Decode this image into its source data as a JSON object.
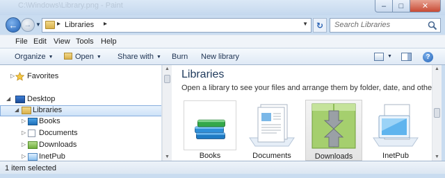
{
  "window": {
    "title": "C:\\Windows\\Library.png - Paint",
    "controls": {
      "minimize": "–",
      "maximize": "□",
      "close": "✕"
    }
  },
  "address": {
    "crumb": "Libraries",
    "search_placeholder": "Search Libraries"
  },
  "menu": [
    "File",
    "Edit",
    "View",
    "Tools",
    "Help"
  ],
  "commands": {
    "organize": "Organize",
    "open": "Open",
    "share_with": "Share with",
    "burn": "Burn",
    "new_library": "New library"
  },
  "nav": {
    "favorites": "Favorites",
    "desktop": "Desktop",
    "libraries": "Libraries",
    "books": "Books",
    "documents": "Documents",
    "downloads": "Downloads",
    "inetpub": "InetPub"
  },
  "content": {
    "title": "Libraries",
    "description": "Open a library to see your files and arrange them by folder, date, and other proper...",
    "tiles": [
      "Books",
      "Documents",
      "Downloads",
      "InetPub"
    ]
  },
  "status": "1 item selected",
  "colors": {
    "accent": "#1e395b",
    "selection": "#cde2f8",
    "frame": "#c9dcf0"
  }
}
